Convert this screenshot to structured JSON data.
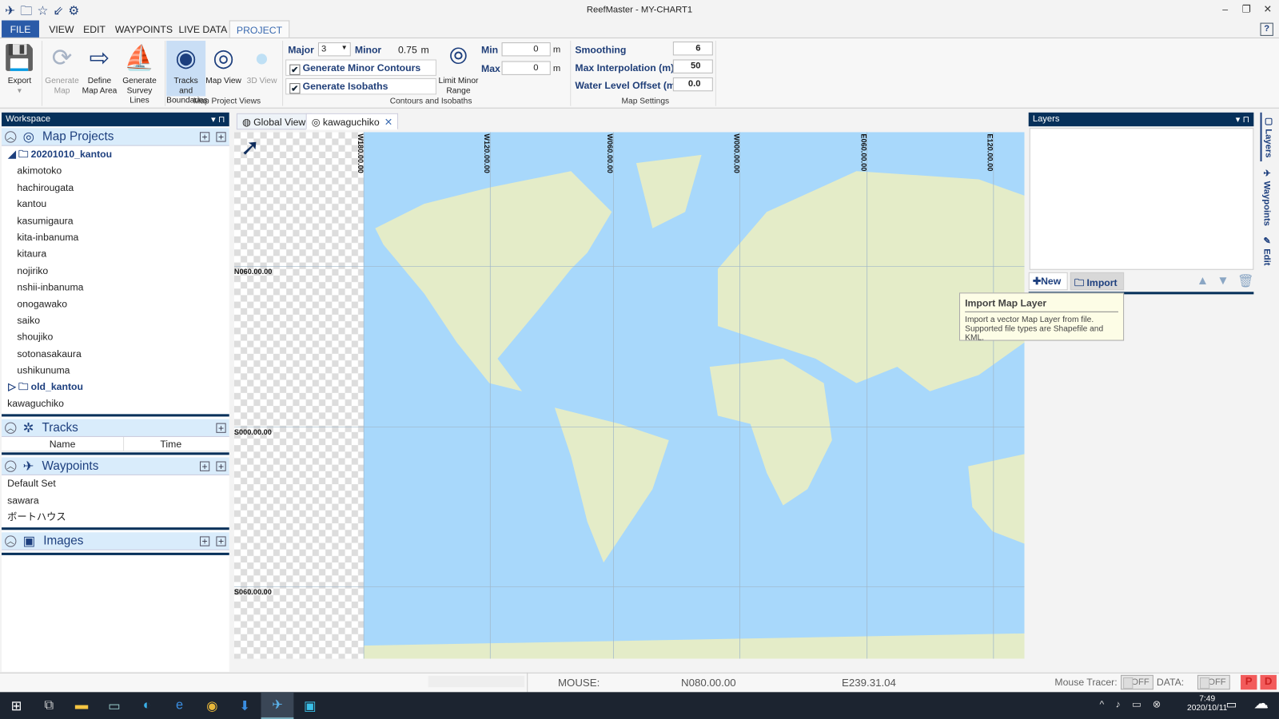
{
  "window": {
    "title": "ReefMaster - MY-CHART1"
  },
  "menu": [
    "FILE",
    "VIEW",
    "EDIT",
    "WAYPOINTS",
    "LIVE DATA",
    "PROJECT"
  ],
  "ribbon": {
    "buttons": [
      {
        "label": "Export",
        "icon": "floppy-icon"
      },
      {
        "label": "Generate Map",
        "icon": "refresh-icon"
      },
      {
        "label": "Define Map Area",
        "icon": "define-area-icon"
      },
      {
        "label": "Generate Survey Lines",
        "icon": "boat-icon"
      },
      {
        "label": "Tracks and Boundaries",
        "icon": "target-icon"
      },
      {
        "label": "Map View",
        "icon": "rings-icon"
      },
      {
        "label": "3D View",
        "icon": "sphere-icon"
      }
    ],
    "group_views": "Map Project Views",
    "major_label": "Major",
    "major_value": "3",
    "minor_label": "Minor",
    "minor_value": "0.75",
    "unit": "m",
    "gen_minor": "Generate Minor Contours",
    "gen_isobaths": "Generate Isobaths",
    "limit_minor": "Limit Minor Range",
    "min_label": "Min",
    "min_value": "0",
    "max_label": "Max",
    "max_value": "0",
    "group_contours": "Contours and Isobaths",
    "smoothing_label": "Smoothing",
    "smoothing_value": "6",
    "maxinterp_label": "Max Interpolation (m)",
    "maxinterp_value": "50",
    "water_label": "Water Level Offset (m)",
    "water_value": "0.0",
    "group_settings": "Map Settings"
  },
  "workspace": {
    "title": "Workspace",
    "map_projects": "Map Projects",
    "folder1": "20201010_kantou",
    "folder1_items": [
      "akimotoko",
      "hachirougata",
      "kantou",
      "kasumigaura",
      "kita-inbanuma",
      "kitaura",
      "nojiriko",
      "nshii-inbanuma",
      "onogawako",
      "saiko",
      "shoujiko",
      "sotonasakaura",
      "ushikunuma"
    ],
    "folder2": "old_kantou",
    "loose_item": "kawaguchiko",
    "tracks": "Tracks",
    "col_name": "Name",
    "col_time": "Time",
    "waypoints": "Waypoints",
    "waypoint_items": [
      "Default Set",
      "sawara",
      "ボートハウス"
    ],
    "images": "Images"
  },
  "tabs": [
    {
      "label": "Global View"
    },
    {
      "label": "kawaguchiko",
      "active": true
    }
  ],
  "map": {
    "lon_labels": [
      "W180.00.00",
      "W120.00.00",
      "W060.00.00",
      "W000.00.00",
      "E060.00.00",
      "E120.00.00"
    ],
    "lat_labels": [
      "N060.00.00",
      "S000.00.00",
      "S060.00.00"
    ],
    "colors": {
      "ocean": "#a8d8fb",
      "land": "#e4ecc8"
    }
  },
  "layers": {
    "title": "Layers",
    "new": "New",
    "import": "Import"
  },
  "tooltip": {
    "title": "Import Map Layer",
    "line1": "Import a vector Map Layer from file.",
    "line2": "Supported file types are Shapefile and KML."
  },
  "side_tabs": [
    "Layers",
    "Waypoints",
    "Edit"
  ],
  "status": {
    "mouse_label": "MOUSE:",
    "lat": "N080.00.00",
    "lon": "E239.31.04",
    "tracer_label": "Mouse Tracer:",
    "tracer_state": "OFF",
    "data_label": "DATA:",
    "data_state": "OFF",
    "p": "P",
    "d": "D"
  },
  "taskbar": {
    "time": "7:49",
    "date": "2020/10/11"
  }
}
